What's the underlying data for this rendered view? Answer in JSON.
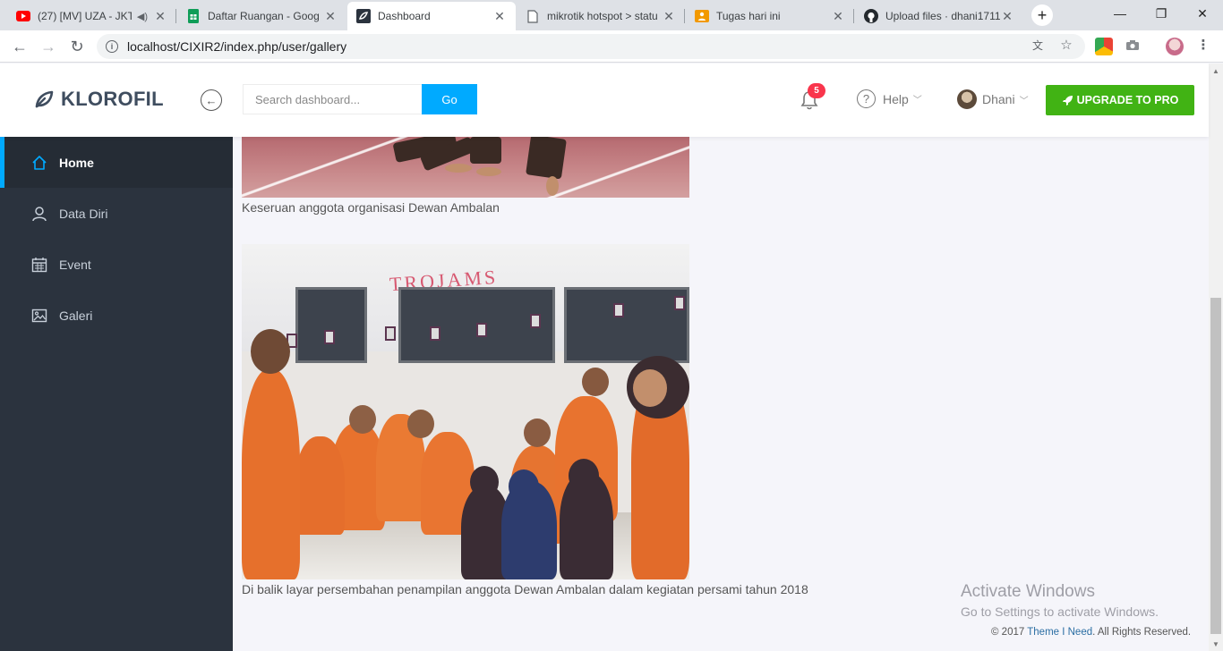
{
  "browser": {
    "tabs": [
      {
        "label": "(27) [MV] UZA - JKT",
        "icon": "youtube-icon",
        "audio": true
      },
      {
        "label": "Daftar Ruangan - Goog",
        "icon": "sheets-icon"
      },
      {
        "label": "Dashboard",
        "icon": "dashboard-icon",
        "active": true
      },
      {
        "label": "mikrotik hotspot > statu",
        "icon": "document-icon"
      },
      {
        "label": "Tugas hari ini",
        "icon": "classroom-icon"
      },
      {
        "label": "Upload files · dhani1711",
        "icon": "github-icon"
      }
    ],
    "url": "localhost/CIXIR2/index.php/user/gallery"
  },
  "header": {
    "brand": "KLOROFIL",
    "search_placeholder": "Search dashboard...",
    "go_label": "Go",
    "notification_count": "5",
    "help_label": "Help",
    "user_name": "Dhani",
    "upgrade_label": "UPGRADE TO PRO"
  },
  "sidebar": {
    "items": [
      {
        "label": "Home",
        "icon": "home-icon",
        "active": true
      },
      {
        "label": "Data Diri",
        "icon": "user-icon"
      },
      {
        "label": "Event",
        "icon": "calendar-icon"
      },
      {
        "label": "Galeri",
        "icon": "image-icon"
      }
    ]
  },
  "gallery": {
    "items": [
      {
        "caption": "Keseruan anggota organisasi Dewan Ambalan"
      },
      {
        "caption": "Di balik layar persembahan penampilan anggota Dewan Ambalan dalam kegiatan persami tahun 2018",
        "sign_text": "TROJAMS"
      }
    ]
  },
  "windows_watermark": {
    "title": "Activate Windows",
    "subtitle": "Go to Settings to activate Windows."
  },
  "footer": {
    "prefix": "© 2017 ",
    "link": "Theme I Need",
    "suffix": ". All Rights Reserved."
  },
  "colors": {
    "accent": "#00aaff",
    "upgrade": "#41b314",
    "sidebar": "#2b333e",
    "badge": "#f9354c"
  }
}
